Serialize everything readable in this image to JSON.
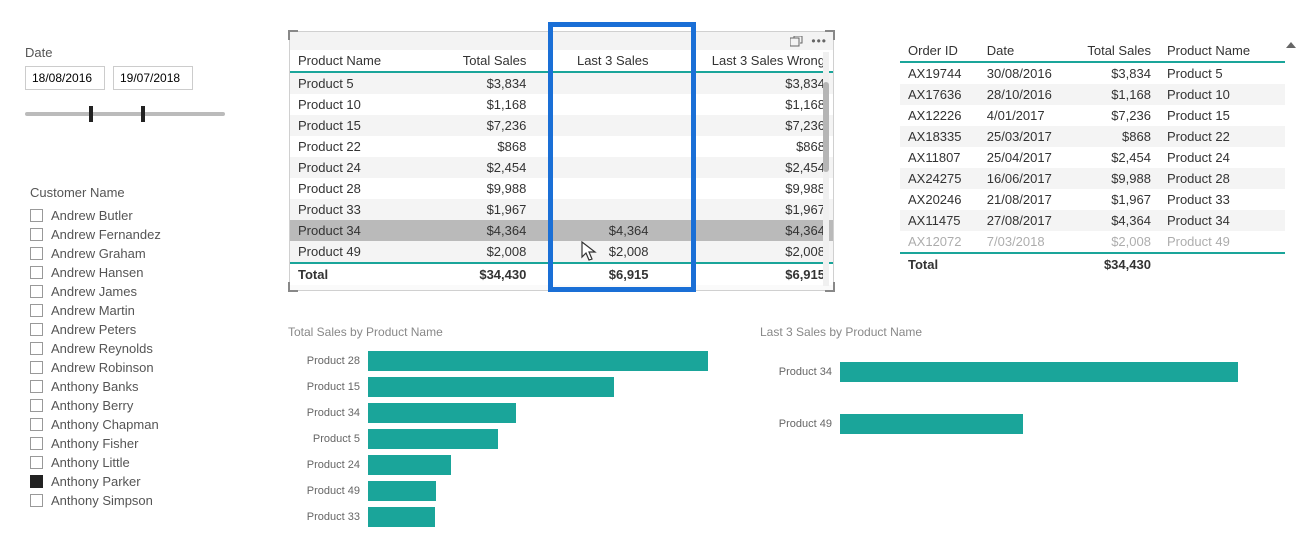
{
  "date_slicer": {
    "label": "Date",
    "from": "18/08/2016",
    "to": "19/07/2018"
  },
  "customer_slicer": {
    "label": "Customer Name",
    "items": [
      {
        "name": "Andrew Butler",
        "checked": false
      },
      {
        "name": "Andrew Fernandez",
        "checked": false
      },
      {
        "name": "Andrew Graham",
        "checked": false
      },
      {
        "name": "Andrew Hansen",
        "checked": false
      },
      {
        "name": "Andrew James",
        "checked": false
      },
      {
        "name": "Andrew Martin",
        "checked": false
      },
      {
        "name": "Andrew Peters",
        "checked": false
      },
      {
        "name": "Andrew Reynolds",
        "checked": false
      },
      {
        "name": "Andrew Robinson",
        "checked": false
      },
      {
        "name": "Anthony Banks",
        "checked": false
      },
      {
        "name": "Anthony Berry",
        "checked": false
      },
      {
        "name": "Anthony Chapman",
        "checked": false
      },
      {
        "name": "Anthony Fisher",
        "checked": false
      },
      {
        "name": "Anthony Little",
        "checked": false
      },
      {
        "name": "Anthony Parker",
        "checked": true
      },
      {
        "name": "Anthony Simpson",
        "checked": false
      }
    ]
  },
  "table1": {
    "columns": [
      "Product Name",
      "Total Sales",
      "Last 3 Sales",
      "Last 3 Sales Wrong"
    ],
    "rows": [
      {
        "product": "Product 5",
        "total": "$3,834",
        "last3": "",
        "wrong": "$3,834"
      },
      {
        "product": "Product 10",
        "total": "$1,168",
        "last3": "",
        "wrong": "$1,168"
      },
      {
        "product": "Product 15",
        "total": "$7,236",
        "last3": "",
        "wrong": "$7,236"
      },
      {
        "product": "Product 22",
        "total": "$868",
        "last3": "",
        "wrong": "$868"
      },
      {
        "product": "Product 24",
        "total": "$2,454",
        "last3": "",
        "wrong": "$2,454"
      },
      {
        "product": "Product 28",
        "total": "$9,988",
        "last3": "",
        "wrong": "$9,988"
      },
      {
        "product": "Product 33",
        "total": "$1,967",
        "last3": "",
        "wrong": "$1,967"
      },
      {
        "product": "Product 34",
        "total": "$4,364",
        "last3": "$4,364",
        "wrong": "$4,364",
        "highlight": true
      },
      {
        "product": "Product 49",
        "total": "$2,008",
        "last3": "$2,008",
        "wrong": "$2,008"
      }
    ],
    "total": {
      "label": "Total",
      "total": "$34,430",
      "last3": "$6,915",
      "wrong": "$6,915"
    }
  },
  "table2": {
    "columns": [
      "Order ID",
      "Date",
      "Total Sales",
      "Product Name"
    ],
    "rows": [
      {
        "order": "AX19744",
        "date": "30/08/2016",
        "sales": "$3,834",
        "product": "Product 5"
      },
      {
        "order": "AX17636",
        "date": "28/10/2016",
        "sales": "$1,168",
        "product": "Product 10"
      },
      {
        "order": "AX12226",
        "date": "4/01/2017",
        "sales": "$7,236",
        "product": "Product 15"
      },
      {
        "order": "AX18335",
        "date": "25/03/2017",
        "sales": "$868",
        "product": "Product 22"
      },
      {
        "order": "AX11807",
        "date": "25/04/2017",
        "sales": "$2,454",
        "product": "Product 24"
      },
      {
        "order": "AX24275",
        "date": "16/06/2017",
        "sales": "$9,988",
        "product": "Product 28"
      },
      {
        "order": "AX20246",
        "date": "21/08/2017",
        "sales": "$1,967",
        "product": "Product 33"
      },
      {
        "order": "AX11475",
        "date": "27/08/2017",
        "sales": "$4,364",
        "product": "Product 34"
      },
      {
        "order": "AX12072",
        "date": "7/03/2018",
        "sales": "$2,008",
        "product": "Product 49"
      }
    ],
    "total": {
      "label": "Total",
      "sales": "$34,430"
    }
  },
  "chart_data": [
    {
      "type": "bar",
      "title": "Total Sales by Product Name",
      "xlabel": "",
      "ylabel": "",
      "categories": [
        "Product 28",
        "Product 15",
        "Product 34",
        "Product 5",
        "Product 24",
        "Product 49",
        "Product 33"
      ],
      "values": [
        9988,
        7236,
        4364,
        3834,
        2454,
        2008,
        1967
      ],
      "xlim": [
        0,
        10000
      ]
    },
    {
      "type": "bar",
      "title": "Last 3 Sales by Product Name",
      "xlabel": "",
      "ylabel": "",
      "categories": [
        "Product 34",
        "Product 49"
      ],
      "values": [
        4364,
        2008
      ],
      "xlim": [
        0,
        4500
      ]
    }
  ],
  "colors": {
    "accent": "#1aa59a",
    "highlight_border": "#1a6fd6"
  }
}
